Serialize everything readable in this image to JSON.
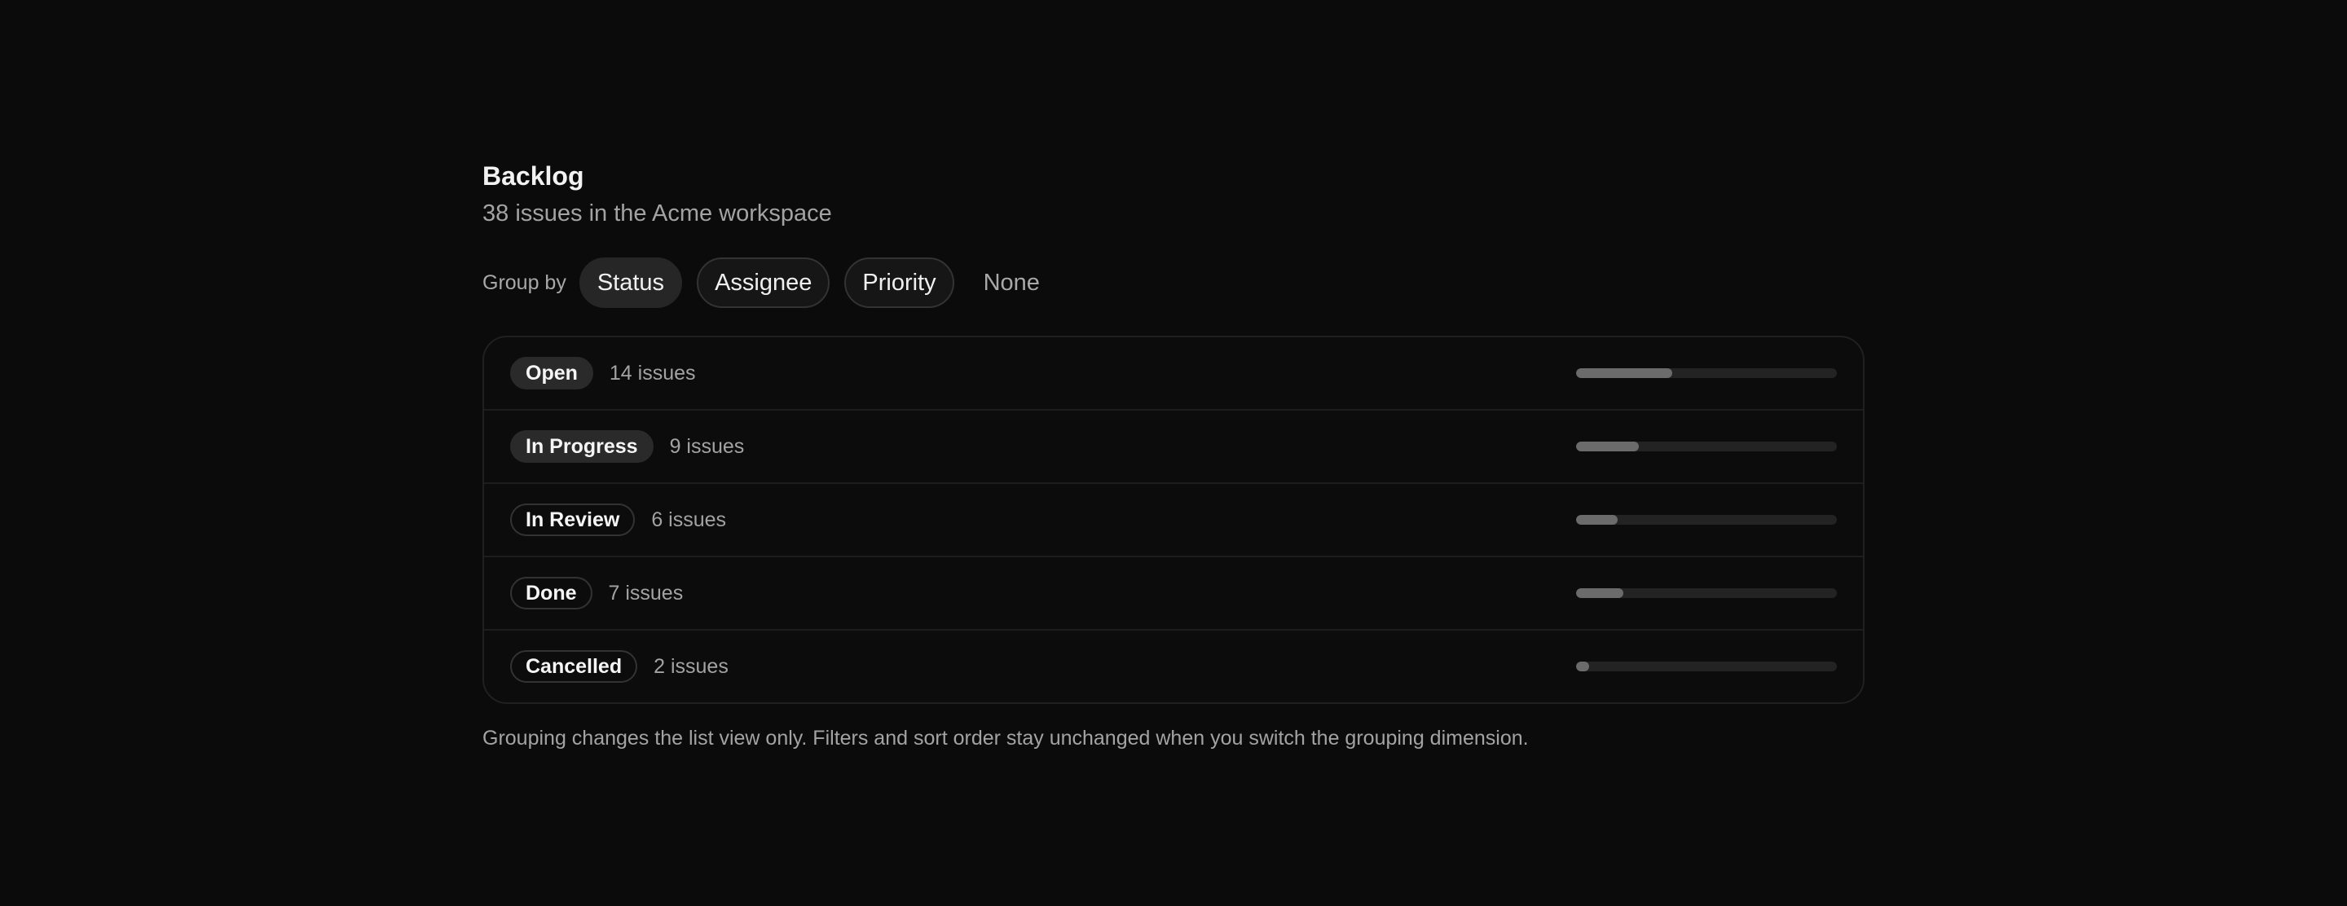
{
  "header": {
    "title": "Backlog",
    "subtitle": "38 issues in the Acme workspace"
  },
  "group_by": {
    "label": "Group by",
    "options": [
      {
        "label": "Status",
        "selected": true
      },
      {
        "label": "Assignee",
        "selected": false
      },
      {
        "label": "Priority",
        "selected": false
      },
      {
        "label": "None",
        "selected": false
      }
    ]
  },
  "groups": [
    {
      "status": "Open",
      "count_label": "14 issues",
      "share": 0.37
    },
    {
      "status": "In Progress",
      "count_label": "9 issues",
      "share": 0.24
    },
    {
      "status": "In Review",
      "count_label": "6 issues",
      "share": 0.16
    },
    {
      "status": "Done",
      "count_label": "7 issues",
      "share": 0.18
    },
    {
      "status": "Cancelled",
      "count_label": "2 issues",
      "share": 0.05
    }
  ],
  "footnote": "Grouping changes the list view only. Filters and sort order stay unchanged when you switch the grouping dimension."
}
